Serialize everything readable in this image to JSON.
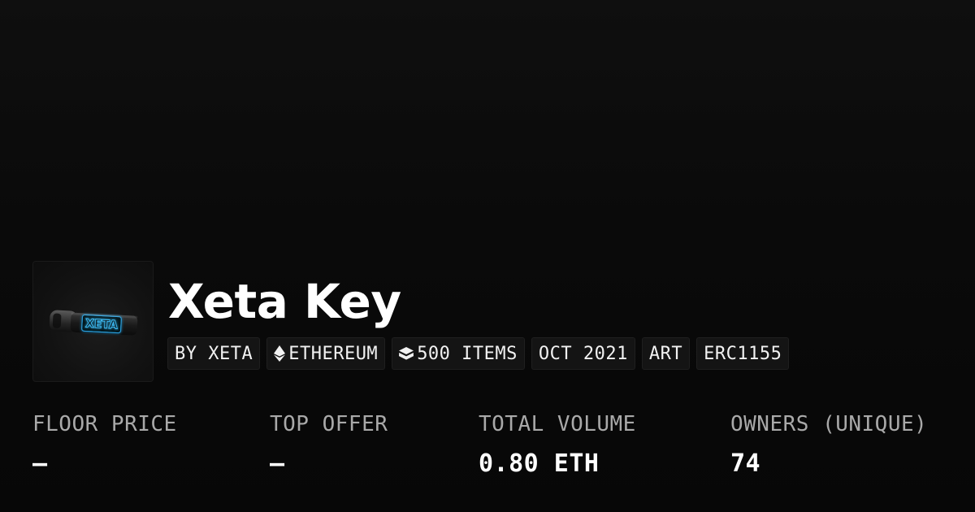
{
  "collection": {
    "name": "Xeta Key",
    "thumbnail_text": "XETA",
    "tags": [
      {
        "label": "BY XETA",
        "icon": ""
      },
      {
        "label": "ETHEREUM",
        "icon": "ethereum-icon"
      },
      {
        "label": "500 ITEMS",
        "icon": "layers-icon"
      },
      {
        "label": "OCT 2021",
        "icon": ""
      },
      {
        "label": "ART",
        "icon": ""
      },
      {
        "label": "ERC1155",
        "icon": ""
      }
    ]
  },
  "stats": [
    {
      "label": "FLOOR PRICE",
      "value": "–"
    },
    {
      "label": "TOP OFFER",
      "value": "–"
    },
    {
      "label": "TOTAL VOLUME",
      "value": "0.80 ETH"
    },
    {
      "label": "OWNERS (UNIQUE)",
      "value": "74"
    }
  ],
  "colors": {
    "background": "#0b0b0b",
    "text": "#ffffff",
    "muted_text": "#a9a9a9",
    "tag_background": "#141414",
    "key_glow": "#2fb7ff"
  }
}
